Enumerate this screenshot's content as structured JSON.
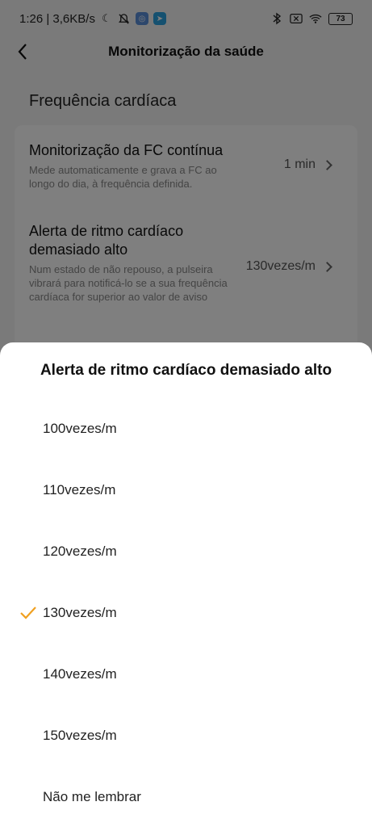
{
  "status_bar": {
    "time_speed": "1:26 | 3,6KB/s",
    "battery": "73",
    "icons": [
      "moon-icon",
      "bell-muted-icon",
      "app-badge-icon",
      "telegram-icon",
      "bluetooth-icon",
      "sim-icon",
      "wifi-icon",
      "battery-icon"
    ]
  },
  "nav": {
    "title": "Monitorização da saúde"
  },
  "section": {
    "title": "Frequência cardíaca"
  },
  "rows": [
    {
      "title": "Monitorização da FC contínua",
      "desc": "Mede automaticamente e grava a FC ao longo do dia, à frequência definida.",
      "value": "1 min"
    },
    {
      "title": "Alerta de ritmo cardíaco demasiado alto",
      "desc": "Num estado de não repouso, a pulseira vibrará para notificá-lo se a sua frequência cardíaca for superior ao valor de aviso",
      "value": "130vezes/m"
    }
  ],
  "sheet": {
    "title": "Alerta de ritmo cardíaco demasiado alto",
    "options": [
      "100vezes/m",
      "110vezes/m",
      "120vezes/m",
      "130vezes/m",
      "140vezes/m",
      "150vezes/m",
      "Não me lembrar"
    ],
    "selected": "130vezes/m",
    "accent": "#f0a020"
  }
}
